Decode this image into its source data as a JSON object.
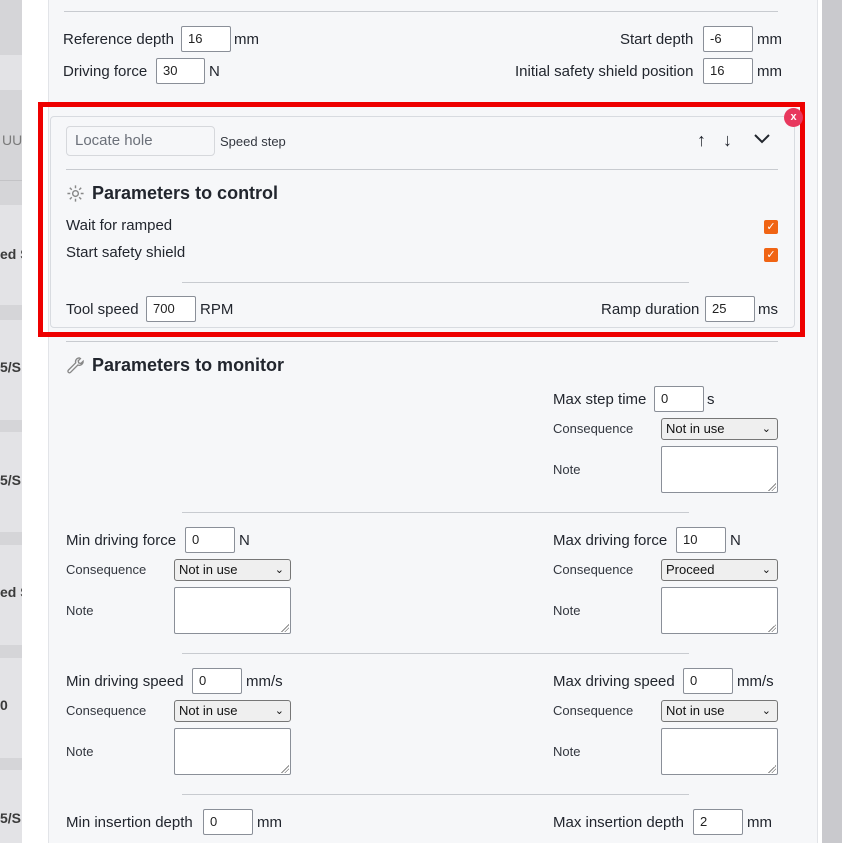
{
  "background": {
    "labels": [
      "ed S",
      "5/S",
      "5/S",
      "ed S",
      "0",
      "5/S"
    ],
    "uu": "UU"
  },
  "top_params": {
    "reference_depth_label": "Reference depth",
    "reference_depth_value": "16",
    "reference_depth_unit": "mm",
    "driving_force_label": "Driving force",
    "driving_force_value": "30",
    "driving_force_unit": "N",
    "start_depth_label": "Start depth",
    "start_depth_value": "-6",
    "start_depth_unit": "mm",
    "initial_shield_label": "Initial safety shield position",
    "initial_shield_value": "16",
    "initial_shield_unit": "mm"
  },
  "step": {
    "name_placeholder": "Locate hole",
    "type": "Speed step",
    "close_label": "x",
    "control_title": "Parameters to control",
    "wait_for_ramped": "Wait for ramped",
    "wait_for_ramped_checked": true,
    "start_safety_shield": "Start safety shield",
    "start_safety_shield_checked": true,
    "tool_speed_label": "Tool speed",
    "tool_speed_value": "700",
    "tool_speed_unit": "RPM",
    "ramp_duration_label": "Ramp duration",
    "ramp_duration_value": "25",
    "ramp_duration_unit": "ms",
    "highlight_color": "#ee0000",
    "checkbox_color": "#f06414"
  },
  "monitor": {
    "title": "Parameters to monitor",
    "consequence_label": "Consequence",
    "note_label": "Note",
    "max_step_time_label": "Max step time",
    "max_step_time_value": "0",
    "max_step_time_unit": "s",
    "max_step_time_consequence": "Not in use",
    "min_driving_force_label": "Min driving force",
    "min_driving_force_value": "0",
    "min_driving_force_unit": "N",
    "min_driving_force_consequence": "Not in use",
    "max_driving_force_label": "Max driving force",
    "max_driving_force_value": "10",
    "max_driving_force_unit": "N",
    "max_driving_force_consequence": "Proceed",
    "min_driving_speed_label": "Min driving speed",
    "min_driving_speed_value": "0",
    "min_driving_speed_unit": "mm/s",
    "min_driving_speed_consequence": "Not in use",
    "max_driving_speed_label": "Max driving speed",
    "max_driving_speed_value": "0",
    "max_driving_speed_unit": "mm/s",
    "max_driving_speed_consequence": "Not in use",
    "min_insertion_depth_label": "Min insertion depth",
    "min_insertion_depth_value": "0",
    "min_insertion_depth_unit": "mm",
    "max_insertion_depth_label": "Max insertion depth",
    "max_insertion_depth_value": "2",
    "max_insertion_depth_unit": "mm"
  }
}
